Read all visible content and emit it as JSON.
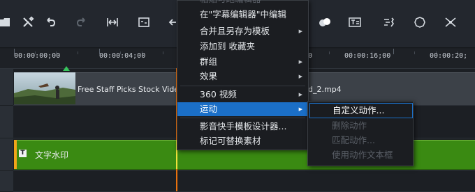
{
  "toolbar": {
    "icons": [
      "save-icon",
      "tools-icon",
      "undo-icon",
      "redo-icon",
      "fit-width-icon",
      "subtitle-icon",
      "nav-left-icon",
      "color-icon",
      "text-icon",
      "motion-icon",
      "mask-icon",
      "more-icon"
    ]
  },
  "ruler": {
    "timecodes": [
      "00:00:00;00",
      "00:00:04;00",
      "00:00:16;00",
      "00:00:20;"
    ],
    "partial": "0"
  },
  "tracks": {
    "video_clip_label": "Free Staff Picks Stock Video",
    "video_clip_label_2": "d_2.mp4",
    "title_clip_label": "文字水印",
    "title_clip_icon": "T"
  },
  "context_menu": {
    "faded_top": "粘贴可跑编辑器",
    "items": [
      {
        "label": "在\"字幕编辑器\"中编辑",
        "submenu": false
      },
      {
        "label": "合并且另存为模板",
        "submenu": true
      },
      {
        "label": "添加到 收藏夹",
        "submenu": false
      },
      {
        "label": "群组",
        "submenu": true
      },
      {
        "label": "效果",
        "submenu": true
      },
      {
        "label": "360 视频",
        "submenu": true
      },
      {
        "label": "运动",
        "submenu": true,
        "highlighted": true
      },
      {
        "label": "影音快手模板设计器...",
        "submenu": false
      },
      {
        "label": "标记可替换素材",
        "submenu": false
      }
    ]
  },
  "submenu": {
    "items": [
      {
        "label": "自定义动作...",
        "enabled": true
      },
      {
        "label": "删除动作",
        "enabled": false
      },
      {
        "label": "匹配动作...",
        "enabled": false
      },
      {
        "label": "使用动作文本框",
        "enabled": false
      }
    ]
  },
  "colors": {
    "highlight": "#1b6fc7",
    "title_track": "#3a8a12",
    "playhead": "#e8710e"
  }
}
